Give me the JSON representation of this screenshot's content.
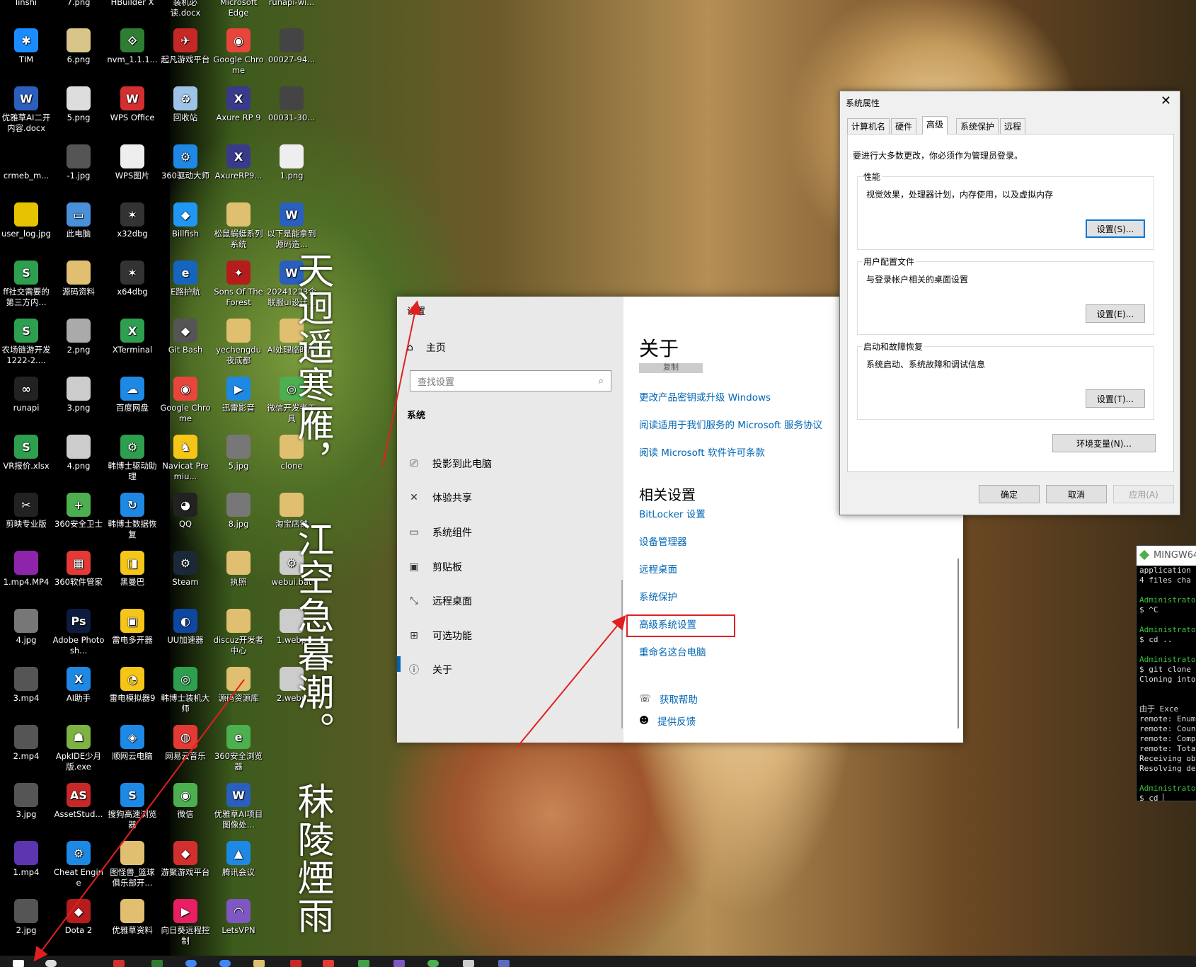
{
  "desktop": {
    "top_labels": [
      "linshi",
      "7.png",
      "HBuilder X",
      "装机必读.docx",
      "Microsoft Edge",
      "runapi-wi..."
    ],
    "icons": [
      {
        "label": "TIM",
        "color": "#1a8cff",
        "glyph": "✱"
      },
      {
        "label": "6.png",
        "color": "#d8c58a",
        "glyph": ""
      },
      {
        "label": "nvm_1.1.1...",
        "color": "#2e7d32",
        "glyph": "⟐"
      },
      {
        "label": "起凡游戏平台",
        "color": "#c62828",
        "glyph": "✈"
      },
      {
        "label": "Google Chrome",
        "color": "#e8453c",
        "glyph": "◉"
      },
      {
        "label": "00027-94...",
        "color": "#444",
        "glyph": ""
      },
      {
        "label": "优雅草AI二开内容.docx",
        "color": "#2b5fbd",
        "glyph": "W"
      },
      {
        "label": "5.png",
        "color": "#ddd",
        "glyph": ""
      },
      {
        "label": "WPS Office",
        "color": "#d32f2f",
        "glyph": "W"
      },
      {
        "label": "回收站",
        "color": "#9ec3e8",
        "glyph": "♻"
      },
      {
        "label": "Axure RP 9",
        "color": "#3a3a8a",
        "glyph": "X"
      },
      {
        "label": "00031-30...",
        "color": "#444",
        "glyph": ""
      },
      {
        "label": "crmeb_m...",
        "color": "#000",
        "glyph": ""
      },
      {
        "label": "-1.jpg",
        "color": "#555",
        "glyph": ""
      },
      {
        "label": "WPS图片",
        "color": "#eee",
        "glyph": ""
      },
      {
        "label": "360驱动大师",
        "color": "#1e88e5",
        "glyph": "⚙"
      },
      {
        "label": "AxureRP9...",
        "color": "#3a3a8a",
        "glyph": "X"
      },
      {
        "label": "1.png",
        "color": "#eee",
        "glyph": ""
      },
      {
        "label": "user_log.jpg",
        "color": "#e6c200",
        "glyph": ""
      },
      {
        "label": "此电脑",
        "color": "#4a90d9",
        "glyph": "▭"
      },
      {
        "label": "x32dbg",
        "color": "#333",
        "glyph": "✶"
      },
      {
        "label": "Billfish",
        "color": "#2196f3",
        "glyph": "◆"
      },
      {
        "label": "松鼠蜗蜓系列系统",
        "color": "#e0c070",
        "glyph": ""
      },
      {
        "label": "以下是能拿到源码造...",
        "color": "#2b5fbd",
        "glyph": "W"
      },
      {
        "label": "ff社交需要的第三方内...",
        "color": "#2e9e4f",
        "glyph": "S"
      },
      {
        "label": "源码资料",
        "color": "#e0c070",
        "glyph": ""
      },
      {
        "label": "x64dbg",
        "color": "#333",
        "glyph": "✶"
      },
      {
        "label": "E路护航",
        "color": "#1565c0",
        "glyph": "e"
      },
      {
        "label": "Sons Of The Forest",
        "color": "#b71c1c",
        "glyph": "✦"
      },
      {
        "label": "20241223企联服ui设计...",
        "color": "#2b5fbd",
        "glyph": "W"
      },
      {
        "label": "农场链游开发1222-2....",
        "color": "#2e9e4f",
        "glyph": "S"
      },
      {
        "label": "2.png",
        "color": "#aaa",
        "glyph": ""
      },
      {
        "label": "XTerminal",
        "color": "#2e9e4f",
        "glyph": "X"
      },
      {
        "label": "Git Bash",
        "color": "#555",
        "glyph": "◆"
      },
      {
        "label": "yechengdu夜成都",
        "color": "#e0c070",
        "glyph": ""
      },
      {
        "label": "AI处理临时库",
        "color": "#e0c070",
        "glyph": ""
      },
      {
        "label": "runapi",
        "color": "#222",
        "glyph": "∞"
      },
      {
        "label": "3.png",
        "color": "#ccc",
        "glyph": ""
      },
      {
        "label": "百度网盘",
        "color": "#1e88e5",
        "glyph": "☁"
      },
      {
        "label": "Google Chrome",
        "color": "#e8453c",
        "glyph": "◉"
      },
      {
        "label": "迅雷影音",
        "color": "#1e88e5",
        "glyph": "▶"
      },
      {
        "label": "微信开发者工具",
        "color": "#4caf50",
        "glyph": "◎"
      },
      {
        "label": "VR报价.xlsx",
        "color": "#2e9e4f",
        "glyph": "S"
      },
      {
        "label": "4.png",
        "color": "#ccc",
        "glyph": ""
      },
      {
        "label": "韩博士驱动助理",
        "color": "#2e9e4f",
        "glyph": "⚙"
      },
      {
        "label": "Navicat Premiu...",
        "color": "#f5c518",
        "glyph": "♞"
      },
      {
        "label": "5.jpg",
        "color": "#777",
        "glyph": ""
      },
      {
        "label": "clone",
        "color": "#e0c070",
        "glyph": ""
      },
      {
        "label": "剪映专业版",
        "color": "#222",
        "glyph": "✂"
      },
      {
        "label": "360安全卫士",
        "color": "#4caf50",
        "glyph": "+"
      },
      {
        "label": "韩博士数据恢复",
        "color": "#1e88e5",
        "glyph": "↻"
      },
      {
        "label": "QQ",
        "color": "#222",
        "glyph": "◕"
      },
      {
        "label": "8.jpg",
        "color": "#777",
        "glyph": ""
      },
      {
        "label": "淘宝店铺",
        "color": "#e0c070",
        "glyph": ""
      },
      {
        "label": "1.mp4.MP4",
        "color": "#8e24aa",
        "glyph": ""
      },
      {
        "label": "360软件管家",
        "color": "#e53935",
        "glyph": "▦"
      },
      {
        "label": "黑曼巴",
        "color": "#f5c518",
        "glyph": "◨"
      },
      {
        "label": "Steam",
        "color": "#1b2838",
        "glyph": "⚙"
      },
      {
        "label": "执照",
        "color": "#e0c070",
        "glyph": ""
      },
      {
        "label": "webui.bat",
        "color": "#ccc",
        "glyph": "⚙"
      },
      {
        "label": "4.jpg",
        "color": "#777",
        "glyph": ""
      },
      {
        "label": "Adobe Photosh...",
        "color": "#0d1b3e",
        "glyph": "Ps"
      },
      {
        "label": "雷电多开器",
        "color": "#f5c518",
        "glyph": "▣"
      },
      {
        "label": "UU加速器",
        "color": "#0d47a1",
        "glyph": "◐"
      },
      {
        "label": "discuz开发者中心",
        "color": "#e0c070",
        "glyph": ""
      },
      {
        "label": "1.webp",
        "color": "#ccc",
        "glyph": ""
      },
      {
        "label": "3.mp4",
        "color": "#555",
        "glyph": ""
      },
      {
        "label": "AI助手",
        "color": "#1e88e5",
        "glyph": "X"
      },
      {
        "label": "雷电模拟器9",
        "color": "#f5c518",
        "glyph": "◔"
      },
      {
        "label": "韩博士装机大师",
        "color": "#2e9e4f",
        "glyph": "◎"
      },
      {
        "label": "源码资源库",
        "color": "#e0c070",
        "glyph": ""
      },
      {
        "label": "2.webp",
        "color": "#ccc",
        "glyph": ""
      },
      {
        "label": "2.mp4",
        "color": "#555",
        "glyph": ""
      },
      {
        "label": "ApkIDE少月版.exe",
        "color": "#7cb342",
        "glyph": "☗"
      },
      {
        "label": "顺网云电脑",
        "color": "#1e88e5",
        "glyph": "◈"
      },
      {
        "label": "网易云音乐",
        "color": "#e53935",
        "glyph": "◍"
      },
      {
        "label": "360安全浏览器",
        "color": "#4caf50",
        "glyph": "e"
      },
      {
        "label": "",
        "color": "transparent",
        "glyph": ""
      },
      {
        "label": "3.jpg",
        "color": "#555",
        "glyph": ""
      },
      {
        "label": "AssetStud...",
        "color": "#c62828",
        "glyph": "AS"
      },
      {
        "label": "搜狗高速浏览器",
        "color": "#1e88e5",
        "glyph": "S"
      },
      {
        "label": "微信",
        "color": "#4caf50",
        "glyph": "◉"
      },
      {
        "label": "优雅草AI项目图像处...",
        "color": "#2b5fbd",
        "glyph": "W"
      },
      {
        "label": "",
        "color": "transparent",
        "glyph": ""
      },
      {
        "label": "1.mp4",
        "color": "#5e35b1",
        "glyph": ""
      },
      {
        "label": "Cheat Engine",
        "color": "#1e88e5",
        "glyph": "⚙"
      },
      {
        "label": "图怪兽_篮球俱乐部开...",
        "color": "#e0c070",
        "glyph": ""
      },
      {
        "label": "游聚游戏平台",
        "color": "#d32f2f",
        "glyph": "◆"
      },
      {
        "label": "腾讯会议",
        "color": "#1e88e5",
        "glyph": "▲"
      },
      {
        "label": "",
        "color": "transparent",
        "glyph": ""
      },
      {
        "label": "2.jpg",
        "color": "#555",
        "glyph": ""
      },
      {
        "label": "Dota 2",
        "color": "#b71c1c",
        "glyph": "◆"
      },
      {
        "label": "优雅草资料",
        "color": "#e0c070",
        "glyph": ""
      },
      {
        "label": "向日葵远程控制",
        "color": "#e91e63",
        "glyph": "▶"
      },
      {
        "label": "LetsVPN",
        "color": "#7e57c2",
        "glyph": "◠"
      },
      {
        "label": "",
        "color": "transparent",
        "glyph": ""
      }
    ]
  },
  "calligraphy": {
    "col1": "天迥遥寒雁，",
    "col2": "江空急暮潮。",
    "col3": "秣陵煙雨"
  },
  "settings": {
    "window_title": "设置",
    "home": "主页",
    "search_placeholder": "查找设置",
    "section": "系统",
    "nav_items": [
      "投影到此电脑",
      "体验共享",
      "系统组件",
      "剪贴板",
      "远程桌面",
      "可选功能",
      "关于"
    ],
    "content_title": "关于",
    "copy_button": "复制",
    "links_top": [
      "更改产品密钥或升级 Windows",
      "阅读适用于我们服务的 Microsoft 服务协议",
      "阅读 Microsoft 软件许可条款"
    ],
    "related_title": "相关设置",
    "related_links": [
      "BitLocker 设置",
      "设备管理器",
      "远程桌面",
      "系统保护",
      "高级系统设置",
      "重命名这台电脑"
    ],
    "get_help": "获取帮助",
    "feedback": "提供反馈"
  },
  "system_properties": {
    "title": "系统属性",
    "tabs": [
      "计算机名",
      "硬件",
      "高级",
      "系统保护",
      "远程"
    ],
    "active_tab": "高级",
    "admin_note": "要进行大多数更改，你必须作为管理员登录。",
    "performance": {
      "label": "性能",
      "desc": "视觉效果，处理器计划，内存使用，以及虚拟内存",
      "button": "设置(S)..."
    },
    "user_profiles": {
      "label": "用户配置文件",
      "desc": "与登录帐户相关的桌面设置",
      "button": "设置(E)..."
    },
    "startup": {
      "label": "启动和故障恢复",
      "desc": "系统启动、系统故障和调试信息",
      "button": "设置(T)..."
    },
    "env_button": "环境变量(N)...",
    "ok": "确定",
    "cancel": "取消",
    "apply": "应用(A)"
  },
  "terminal": {
    "title": "MINGW64",
    "lines": [
      {
        "text": "application",
        "green": false
      },
      {
        "text": "4 files cha",
        "green": false
      },
      {
        "text": "",
        "green": false
      },
      {
        "text": "Administrato",
        "green": true
      },
      {
        "text": "$ ^C",
        "green": false
      },
      {
        "text": "",
        "green": false
      },
      {
        "text": "Administrato",
        "green": true
      },
      {
        "text": "$ cd ..",
        "green": false
      },
      {
        "text": "",
        "green": false
      },
      {
        "text": "Administrato",
        "green": true
      },
      {
        "text": "$ git clone",
        "green": false
      },
      {
        "text": "Cloning into",
        "green": false
      },
      {
        "text": "",
        "green": false
      },
      {
        "text": "",
        "green": false
      },
      {
        "text": "   由于 Exce",
        "green": false
      },
      {
        "text": "remote: Enum",
        "green": false
      },
      {
        "text": "remote: Coun",
        "green": false
      },
      {
        "text": "remote: Comp",
        "green": false
      },
      {
        "text": "remote: Tota",
        "green": false
      },
      {
        "text": "Receiving ob",
        "green": false
      },
      {
        "text": "Resolving de",
        "green": false
      },
      {
        "text": "",
        "green": false
      },
      {
        "text": "Administrato",
        "green": true
      },
      {
        "text": "$ cd ▏",
        "green": false
      }
    ]
  },
  "colors": {
    "link": "#0066b4",
    "accent": "#0078d7",
    "annotation_red": "#e02020"
  }
}
